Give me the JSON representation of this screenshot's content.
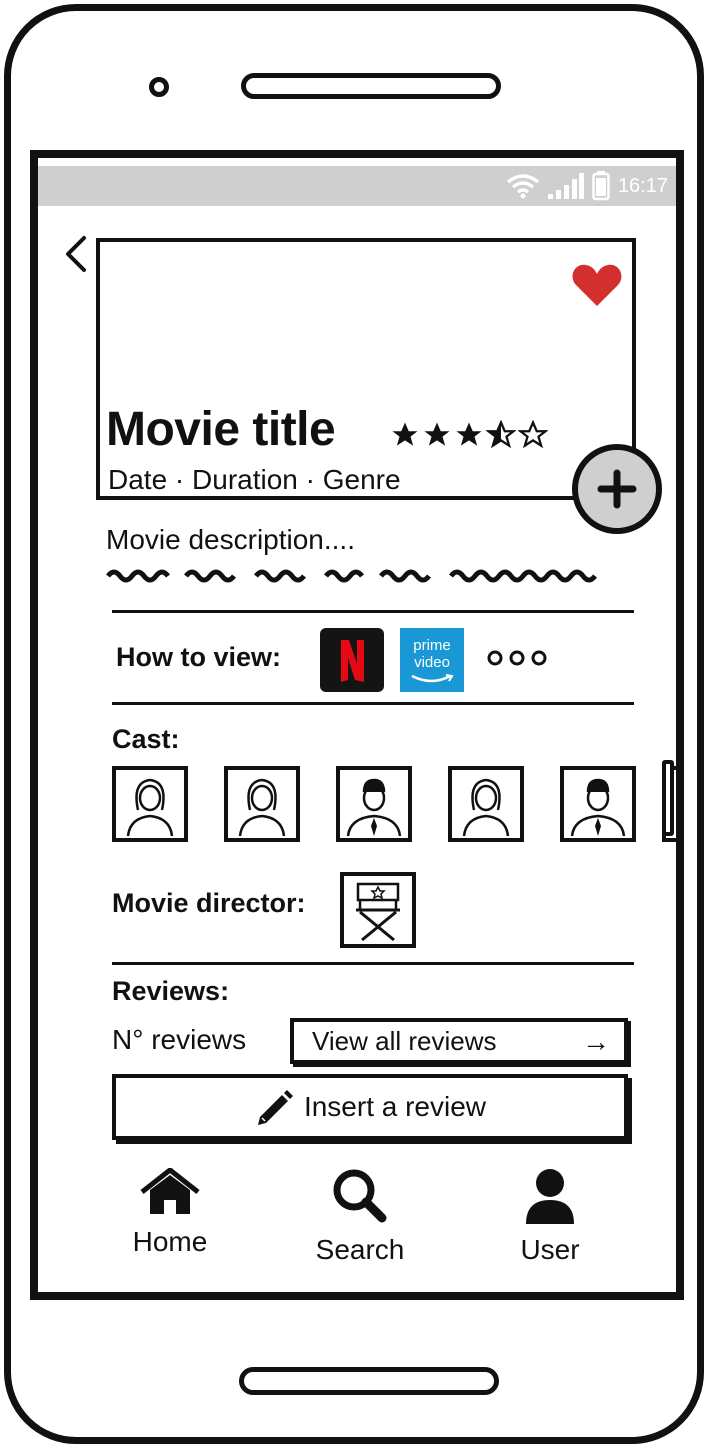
{
  "status": {
    "time": "16:17"
  },
  "movie": {
    "title": "Movie title",
    "rating": 3.5,
    "rating_max": 5,
    "meta": "Date · Duration · Genre",
    "description": "Movie description...."
  },
  "how_to_view": {
    "label": "How to view:",
    "providers": [
      "Netflix",
      "prime video"
    ],
    "netflix_letter": "N",
    "prime_line1": "prime",
    "prime_line2": "video"
  },
  "cast": {
    "label": "Cast:",
    "members": [
      "female",
      "female",
      "male",
      "female",
      "male"
    ]
  },
  "director": {
    "label": "Movie director:"
  },
  "reviews": {
    "label": "Reviews:",
    "count_text": "N° reviews",
    "view_all": "View all reviews",
    "view_all_arrow": "→",
    "insert": "Insert a review"
  },
  "nav": {
    "home": "Home",
    "search": "Search",
    "user": "User"
  },
  "colors": {
    "heart": "#d32f2f",
    "statusbar": "#cfcfcf",
    "prime": "#1a98d5",
    "netflix_bg": "#141414",
    "netflix_red": "#e50914"
  },
  "icons": [
    "back-icon",
    "heart-icon",
    "plus-icon",
    "wifi-icon",
    "signal-icon",
    "battery-icon",
    "pencil-icon",
    "home-icon",
    "search-icon",
    "user-icon"
  ]
}
